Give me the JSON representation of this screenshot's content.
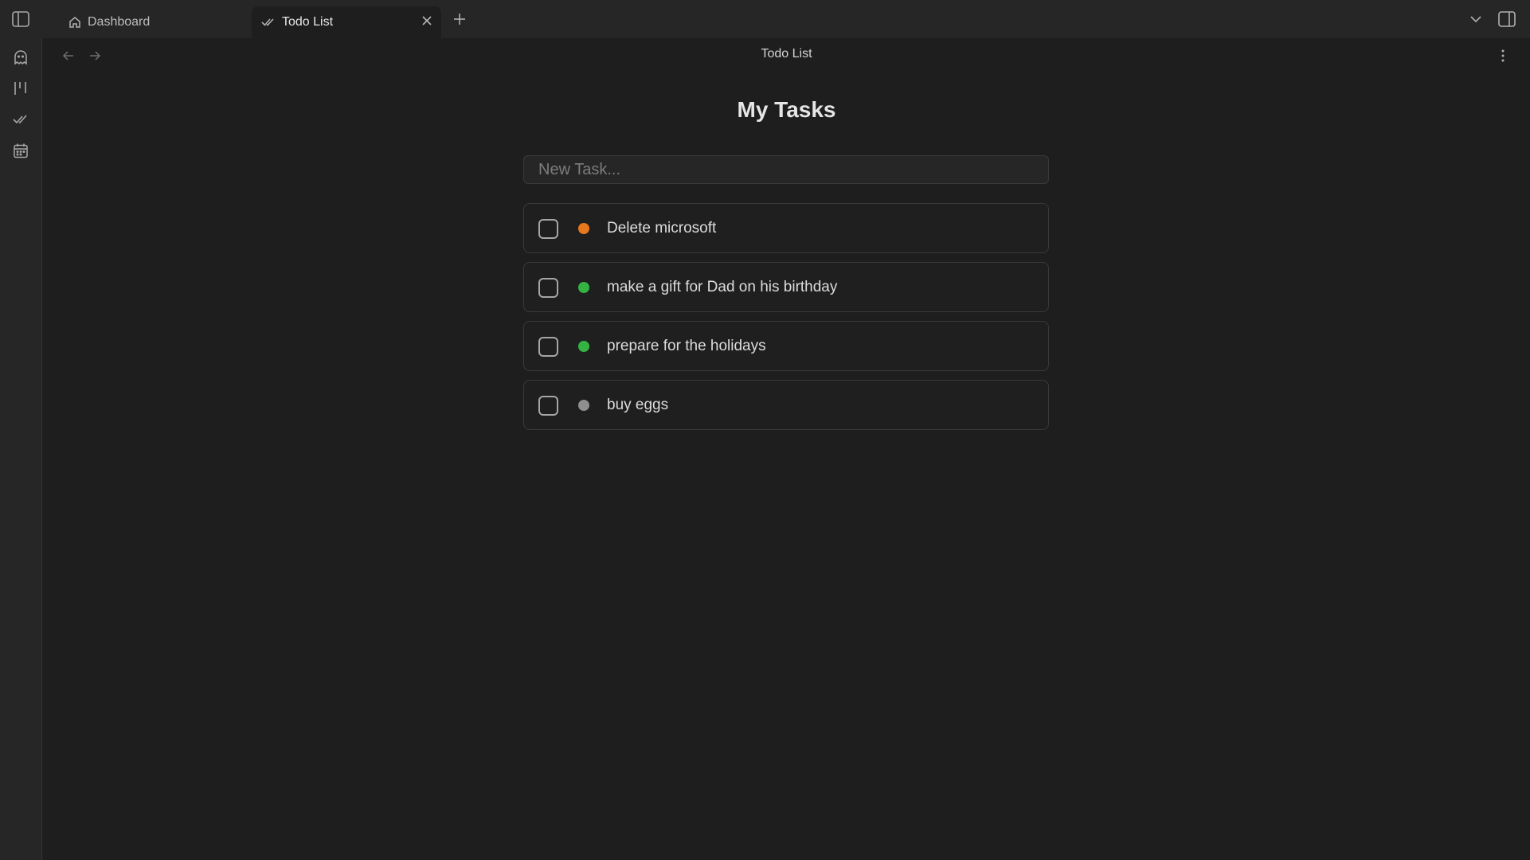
{
  "tabs": [
    {
      "label": "Dashboard",
      "icon": "home-icon",
      "active": false
    },
    {
      "label": "Todo List",
      "icon": "double-check-icon",
      "active": true
    }
  ],
  "view": {
    "title": "Todo List"
  },
  "page": {
    "heading": "My Tasks",
    "input_placeholder": "New Task..."
  },
  "tasks": [
    {
      "label": "Delete microsoft",
      "priority_color": "#e8781e",
      "checked": false
    },
    {
      "label": "make a gift for Dad on his birthday",
      "priority_color": "#35b342",
      "checked": false
    },
    {
      "label": "prepare for the holidays",
      "priority_color": "#35b342",
      "checked": false
    },
    {
      "label": "buy eggs",
      "priority_color": "#8f8f8f",
      "checked": false
    }
  ],
  "ribbon": [
    "ghost-icon",
    "kanban-icon",
    "double-check-icon",
    "calendar-icon"
  ]
}
